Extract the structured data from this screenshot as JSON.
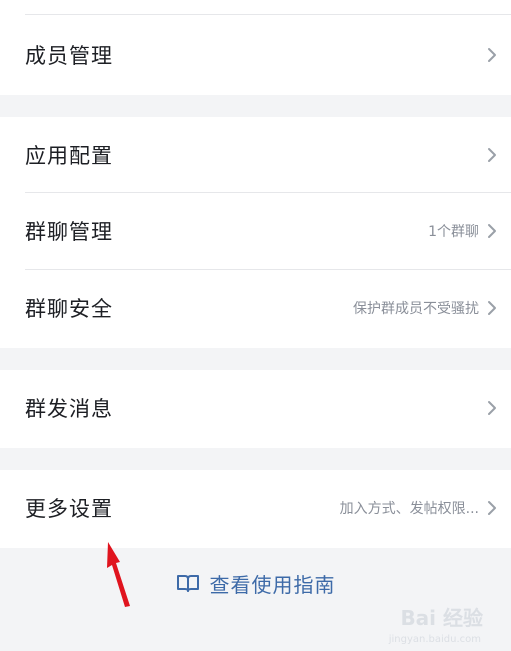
{
  "groups": [
    {
      "rows": [
        {
          "label": "成员管理",
          "value": ""
        }
      ]
    },
    {
      "rows": [
        {
          "label": "应用配置",
          "value": ""
        },
        {
          "label": "群聊管理",
          "value": "1个群聊"
        },
        {
          "label": "群聊安全",
          "value": "保护群成员不受骚扰"
        }
      ]
    },
    {
      "rows": [
        {
          "label": "群发消息",
          "value": ""
        }
      ]
    },
    {
      "rows": [
        {
          "label": "更多设置",
          "value": "加入方式、发帖权限..."
        }
      ]
    }
  ],
  "guide": {
    "label": "查看使用指南",
    "icon": "book-icon"
  },
  "watermark": {
    "brand": "Bai 经验",
    "sub": "jingyan.baidu.com"
  },
  "colors": {
    "accent": "#3d6aa8",
    "arrow": "#e0141e"
  }
}
